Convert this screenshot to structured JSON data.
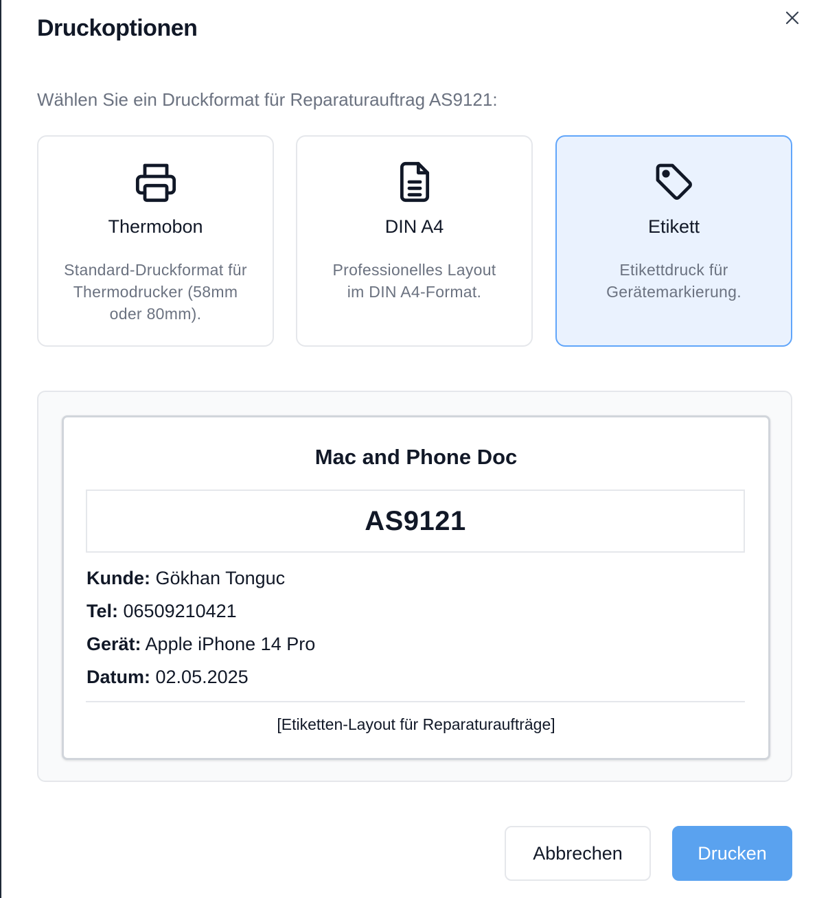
{
  "dialog": {
    "title": "Druckoptionen",
    "subtitle": "Wählen Sie ein Druckformat für Reparaturauftrag AS9121:"
  },
  "options": [
    {
      "icon": "printer-icon",
      "title": "Thermobon",
      "description": "Standard-Druckformat für Thermodrucker (58mm oder 80mm).",
      "selected": false
    },
    {
      "icon": "document-icon",
      "title": "DIN A4",
      "description": "Professionelles Layout im DIN A4-Format.",
      "selected": false
    },
    {
      "icon": "tag-icon",
      "title": "Etikett",
      "description": "Etikettdruck für Gerätemarkierung.",
      "selected": true
    }
  ],
  "preview": {
    "shop_name": "Mac and Phone Doc",
    "order_number": "AS9121",
    "fields": [
      {
        "label": "Kunde:",
        "value": "Gökhan Tonguc"
      },
      {
        "label": "Tel:",
        "value": "06509210421"
      },
      {
        "label": "Gerät:",
        "value": "Apple iPhone 14 Pro"
      },
      {
        "label": "Datum:",
        "value": "02.05.2025"
      }
    ],
    "footer_note": "[Etiketten-Layout für Reparaturaufträge]"
  },
  "buttons": {
    "cancel_label": "Abbrechen",
    "print_label": "Drucken"
  },
  "colors": {
    "accent": "#5aa2ef",
    "selected_border": "#60a5fa",
    "selected_background": "#eaf2fe",
    "muted_text": "#6b7280"
  }
}
